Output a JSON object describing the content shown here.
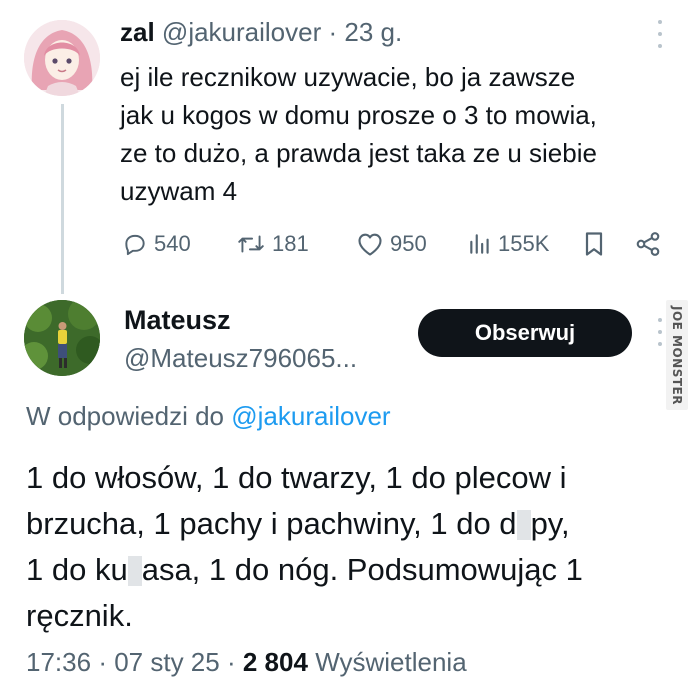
{
  "tweet": {
    "author_name": "zal",
    "author_handle": "@jakurailover",
    "time_ago": "· 23 g.",
    "text_lines": [
      "ej ile recznikow uzywacie, bo ja zawsze",
      "jak u kogos w domu prosze o 3 to mowia,",
      "ze to dużo, a prawda jest taka ze u siebie",
      "uzywam 4"
    ],
    "stats": {
      "replies": "540",
      "reposts": "181",
      "likes": "950",
      "views": "155K"
    },
    "icons": {
      "reply": "comment-icon",
      "repost": "repost-icon",
      "like": "heart-icon",
      "views": "analytics-icon",
      "bookmark": "bookmark-icon",
      "share": "share-icon",
      "more": "more-icon"
    }
  },
  "reply": {
    "author_name": "Mateusz",
    "author_handle": "@Mateusz796065...",
    "follow_label": "Obserwuj",
    "replying_to_prefix": "W odpowiedzi do",
    "replying_to_handle": "@jakurailover",
    "text_lines": [
      [
        "1 do włosów, 1 do twarzy, 1 do plecow i"
      ],
      [
        "brzucha, 1 pachy i pachwiny, 1 do d",
        "py,"
      ],
      [
        "1 do ku",
        "asa, 1 do nóg. Podsumowując 1"
      ],
      [
        "ręcznik."
      ]
    ],
    "time": "17:36",
    "date": "07 sty 25",
    "views_count": "2 804",
    "views_label": "Wyświetlenia"
  },
  "watermark": {
    "text": "JOE MONSTER"
  },
  "colors": {
    "text": "#0f1419",
    "secondary": "#536471",
    "link": "#1d9bf0",
    "button_bg": "#0f1419",
    "thread_line": "#cfd9de"
  }
}
